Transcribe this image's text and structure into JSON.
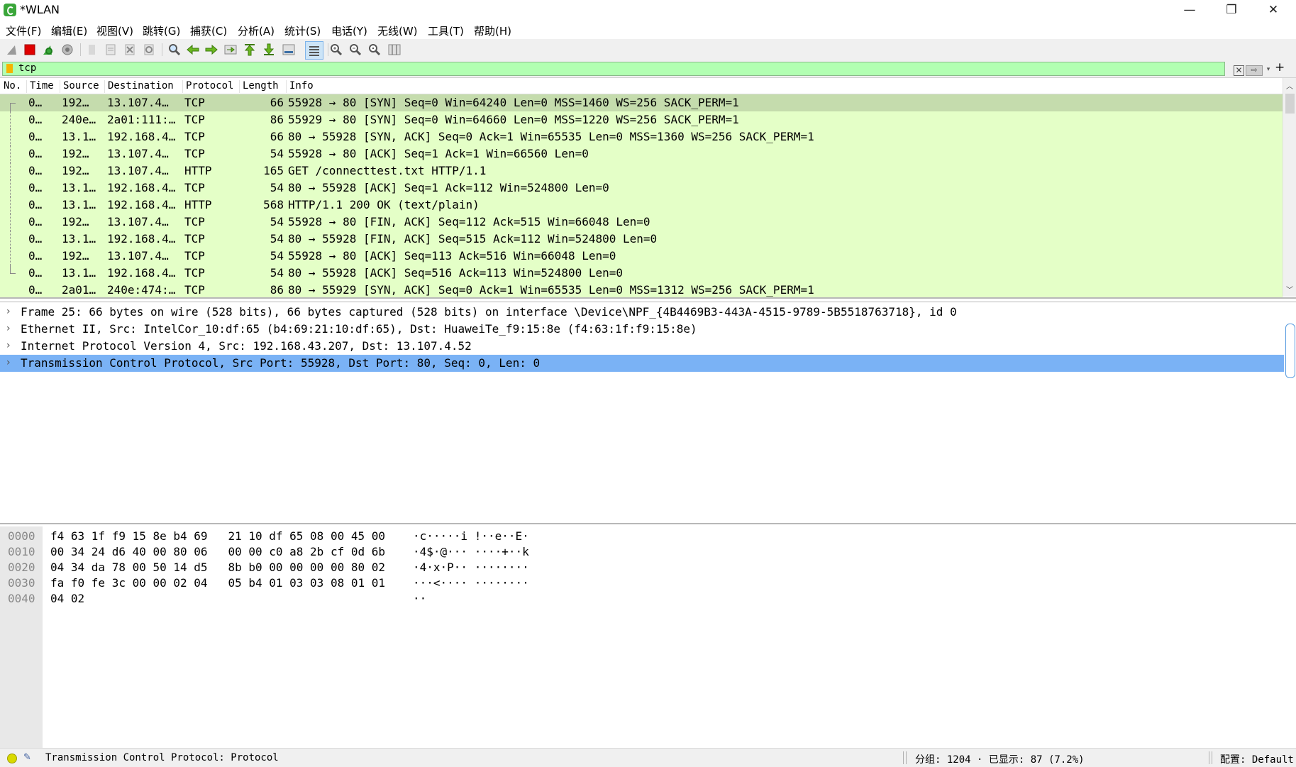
{
  "window": {
    "title": "*WLAN",
    "controls": {
      "minimize": "—",
      "maximize": "❐",
      "close": "✕"
    }
  },
  "menu": [
    {
      "label": "文件(F)"
    },
    {
      "label": "编辑(E)"
    },
    {
      "label": "视图(V)"
    },
    {
      "label": "跳转(G)"
    },
    {
      "label": "捕获(C)"
    },
    {
      "label": "分析(A)"
    },
    {
      "label": "统计(S)"
    },
    {
      "label": "电话(Y)"
    },
    {
      "label": "无线(W)"
    },
    {
      "label": "工具(T)"
    },
    {
      "label": "帮助(H)"
    }
  ],
  "toolbar_icons": [
    "shark-fin-start-icon",
    "stop-capture-icon",
    "restart-capture-icon",
    "capture-options-icon",
    "open-file-icon",
    "save-file-icon",
    "close-file-icon",
    "reload-file-icon",
    "find-packet-icon",
    "go-back-icon",
    "go-forward-icon",
    "go-to-packet-icon",
    "go-first-icon",
    "go-last-icon",
    "autoscroll-icon",
    "colorize-icon",
    "zoom-in-icon",
    "zoom-out-icon",
    "normal-size-icon",
    "resize-columns-icon"
  ],
  "filter": {
    "value": "tcp",
    "clear": "✕",
    "apply": "⇨",
    "dropdown": "▾",
    "add": "+"
  },
  "packet_list": {
    "columns": [
      "No.",
      "Time",
      "Source",
      "Destination",
      "Protocol",
      "Length",
      "Info"
    ],
    "rows": [
      {
        "no": "0…",
        "source": "192…",
        "destination": "13.107.4…",
        "protocol": "TCP",
        "length": "66",
        "info": "55928 → 80 [SYN] Seq=0 Win=64240 Len=0 MSS=1460 WS=256 SACK_PERM=1",
        "selected": true,
        "conv": "start"
      },
      {
        "no": "0…",
        "source": "240e…",
        "destination": "2a01:111:…",
        "protocol": "TCP",
        "length": "86",
        "info": "55929 → 80 [SYN] Seq=0 Win=64660 Len=0 MSS=1220 WS=256 SACK_PERM=1",
        "conv": "mid"
      },
      {
        "no": "0…",
        "source": "13.1…",
        "destination": "192.168.4…",
        "protocol": "TCP",
        "length": "66",
        "info": "80 → 55928 [SYN, ACK] Seq=0 Ack=1 Win=65535 Len=0 MSS=1360 WS=256 SACK_PERM=1",
        "conv": "mid"
      },
      {
        "no": "0…",
        "source": "192…",
        "destination": "13.107.4…",
        "protocol": "TCP",
        "length": "54",
        "info": "55928 → 80 [ACK] Seq=1 Ack=1 Win=66560 Len=0",
        "conv": "mid"
      },
      {
        "no": "0…",
        "source": "192…",
        "destination": "13.107.4…",
        "protocol": "HTTP",
        "length": "165",
        "info": "GET /connecttest.txt HTTP/1.1",
        "conv": "mid"
      },
      {
        "no": "0…",
        "source": "13.1…",
        "destination": "192.168.4…",
        "protocol": "TCP",
        "length": "54",
        "info": "80 → 55928 [ACK] Seq=1 Ack=112 Win=524800 Len=0",
        "conv": "mid"
      },
      {
        "no": "0…",
        "source": "13.1…",
        "destination": "192.168.4…",
        "protocol": "HTTP",
        "length": "568",
        "info": "HTTP/1.1 200 OK  (text/plain)",
        "conv": "mid"
      },
      {
        "no": "0…",
        "source": "192…",
        "destination": "13.107.4…",
        "protocol": "TCP",
        "length": "54",
        "info": "55928 → 80 [FIN, ACK] Seq=112 Ack=515 Win=66048 Len=0",
        "conv": "mid"
      },
      {
        "no": "0…",
        "source": "13.1…",
        "destination": "192.168.4…",
        "protocol": "TCP",
        "length": "54",
        "info": "80 → 55928 [FIN, ACK] Seq=515 Ack=112 Win=524800 Len=0",
        "conv": "mid"
      },
      {
        "no": "0…",
        "source": "192…",
        "destination": "13.107.4…",
        "protocol": "TCP",
        "length": "54",
        "info": "55928 → 80 [ACK] Seq=113 Ack=516 Win=66048 Len=0",
        "conv": "mid"
      },
      {
        "no": "0…",
        "source": "13.1…",
        "destination": "192.168.4…",
        "protocol": "TCP",
        "length": "54",
        "info": "80 → 55928 [ACK] Seq=516 Ack=113 Win=524800 Len=0",
        "conv": "end"
      },
      {
        "no": "0…",
        "source": "2a01…",
        "destination": "240e:474:…",
        "protocol": "TCP",
        "length": "86",
        "info": "80 → 55929 [SYN, ACK] Seq=0 Ack=1 Win=65535 Len=0 MSS=1312 WS=256 SACK_PERM=1",
        "conv": "none"
      }
    ],
    "row_color": "#e4ffc7",
    "selected_row_color": "#c5dcad"
  },
  "details": [
    {
      "text": "Frame 25: 66 bytes on wire (528 bits), 66 bytes captured (528 bits) on interface \\Device\\NPF_{4B4469B3-443A-4515-9789-5B5518763718}, id 0"
    },
    {
      "text": "Ethernet II, Src: IntelCor_10:df:65 (b4:69:21:10:df:65), Dst: HuaweiTe_f9:15:8e (f4:63:1f:f9:15:8e)"
    },
    {
      "text": "Internet Protocol Version 4, Src: 192.168.43.207, Dst: 13.107.4.52"
    },
    {
      "text": "Transmission Control Protocol, Src Port: 55928, Dst Port: 80, Seq: 0, Len: 0",
      "selected": true
    }
  ],
  "bytes": [
    {
      "offset": "0000",
      "hex": "f4 63 1f f9 15 8e b4 69   21 10 df 65 08 00 45 00",
      "ascii": "·c·····i !··e··E·"
    },
    {
      "offset": "0010",
      "hex": "00 34 24 d6 40 00 80 06   00 00 c0 a8 2b cf 0d 6b",
      "ascii": "·4$·@··· ····+··k"
    },
    {
      "offset": "0020",
      "hex": "04 34 da 78 00 50 14 d5   8b b0 00 00 00 00 80 02",
      "ascii": "·4·x·P·· ········"
    },
    {
      "offset": "0030",
      "hex": "fa f0 fe 3c 00 00 02 04   05 b4 01 03 03 08 01 01",
      "ascii": "···<···· ········"
    },
    {
      "offset": "0040",
      "hex": "04 02",
      "ascii": "··"
    }
  ],
  "status": {
    "field_info": "Transmission Control Protocol: Protocol",
    "packets": "分组: 1204 · 已显示: 87 (7.2%)",
    "profile": "配置: Default"
  }
}
